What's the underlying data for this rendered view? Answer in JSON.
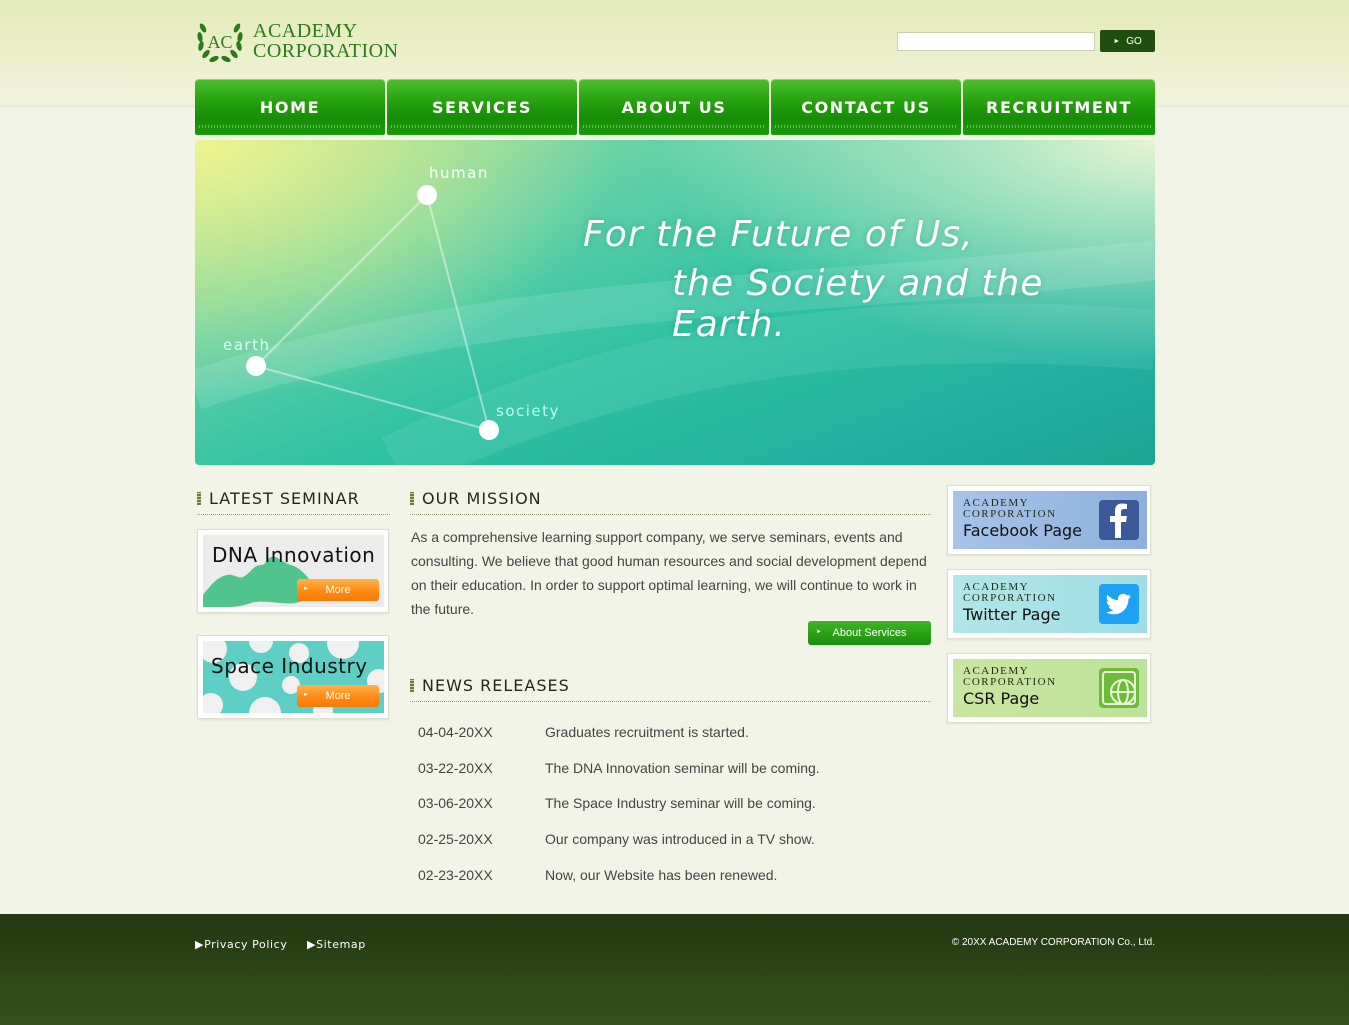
{
  "header": {
    "logo_line1": "ACADEMY",
    "logo_line2": "CORPORATION",
    "logo_mark_text": "AC",
    "search": {
      "value": "",
      "placeholder": ""
    },
    "go_label": "GO"
  },
  "nav": {
    "items": [
      {
        "label": "HOME"
      },
      {
        "label": "SERVICES"
      },
      {
        "label": "ABOUT US"
      },
      {
        "label": "CONTACT US"
      },
      {
        "label": "RECRUITMENT"
      }
    ]
  },
  "hero": {
    "line1": "For the Future of Us,",
    "line2": "the Society and the Earth.",
    "nodes": {
      "human": "human",
      "earth": "earth",
      "society": "society"
    }
  },
  "seminar": {
    "heading": "LATEST SEMINAR",
    "items": [
      {
        "title": "DNA Innovation",
        "more": "More"
      },
      {
        "title": "Space Industry",
        "more": "More"
      }
    ]
  },
  "mission": {
    "heading": "OUR MISSION",
    "text": "As a comprehensive learning support company, we serve seminars, events and consulting. We believe that good human resources and social development depend on their education. In order to support optimal learning, we will continue to work in the future.",
    "button": "About Services"
  },
  "news": {
    "heading": "NEWS RELEASES",
    "items": [
      {
        "date": "04-04-20XX",
        "text": "Graduates recruitment is started."
      },
      {
        "date": "03-22-20XX",
        "text": "The DNA Innovation seminar will be coming."
      },
      {
        "date": "03-06-20XX",
        "text": "The Space Industry seminar will be coming."
      },
      {
        "date": "02-25-20XX",
        "text": "Our company was introduced in a TV show."
      },
      {
        "date": "02-23-20XX",
        "text": "Now, our Website has been renewed."
      }
    ]
  },
  "social": {
    "items": [
      {
        "small1": "ACADEMY",
        "small2": "CORPORATION",
        "label": "Facebook Page",
        "icon": "facebook-icon"
      },
      {
        "small1": "ACADEMY",
        "small2": "CORPORATION",
        "label": "Twitter Page",
        "icon": "twitter-icon"
      },
      {
        "small1": "ACADEMY",
        "small2": "CORPORATION",
        "label": "CSR Page",
        "icon": "globe-icon"
      }
    ]
  },
  "footer": {
    "links": [
      "Privacy Policy",
      "Sitemap"
    ],
    "copyright": "© 20XX ACADEMY CORPORATION Co., Ltd."
  },
  "colors": {
    "brand_green": "#2aa512",
    "accent_orange": "#ff8a12",
    "footer_dark": "#22370f"
  }
}
